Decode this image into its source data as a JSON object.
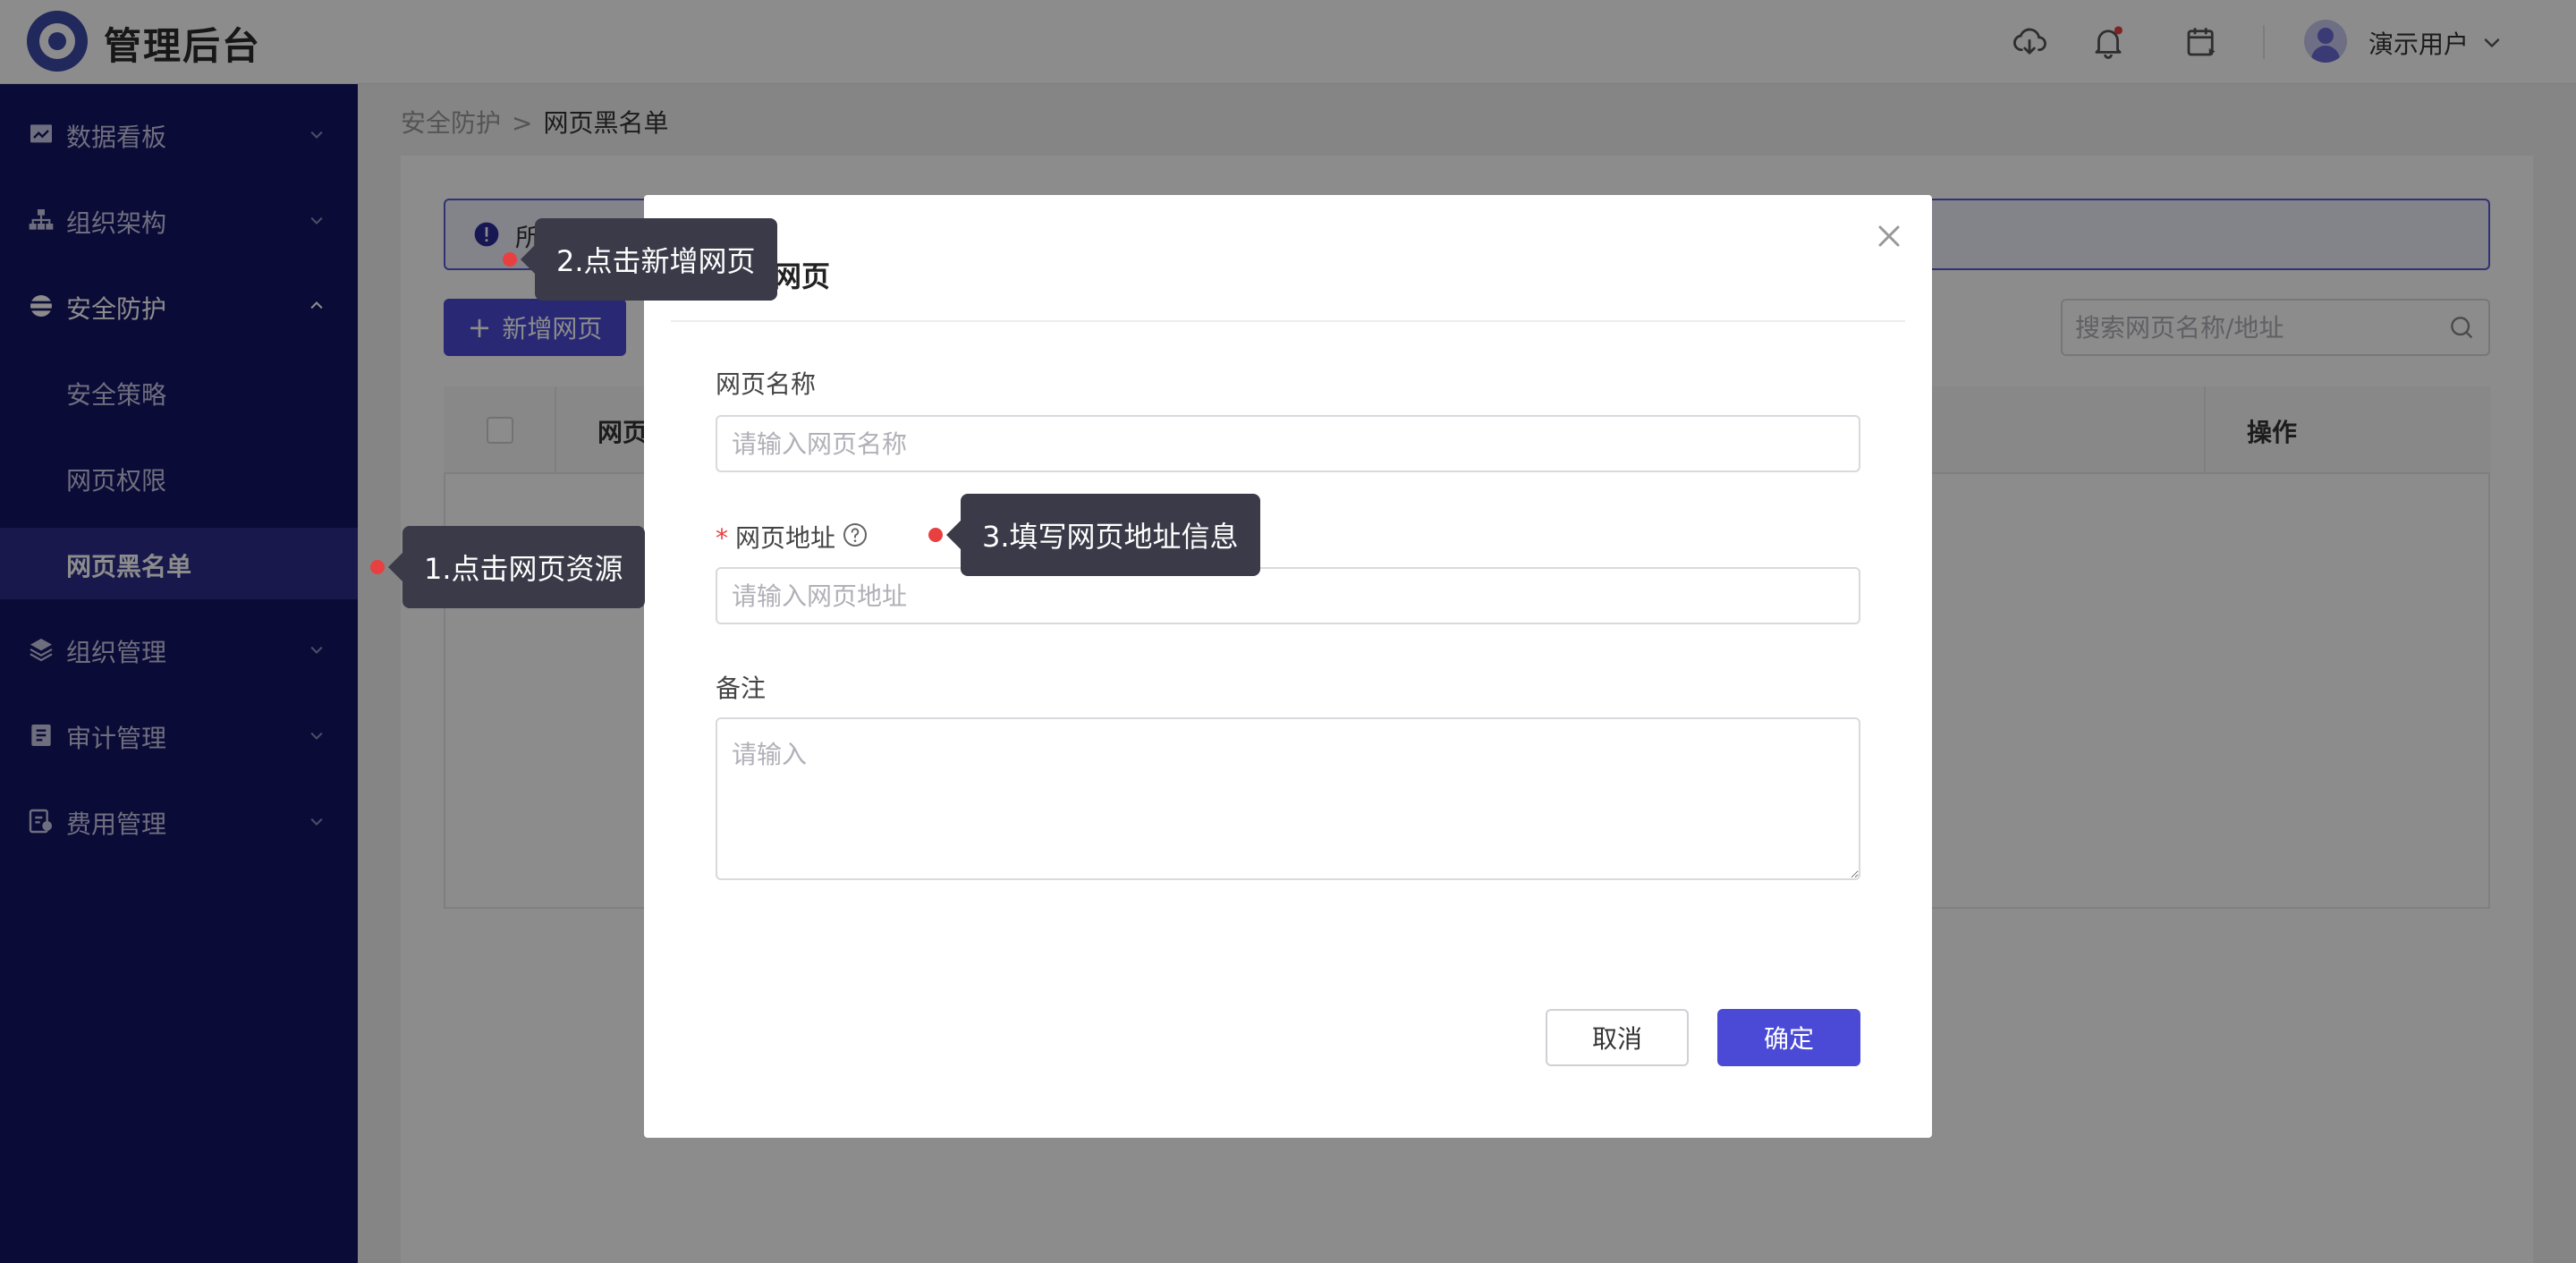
{
  "header": {
    "app_title": "管理后台",
    "icons": [
      "cloud-download-icon",
      "bell-icon",
      "calendar-icon"
    ],
    "user_name": "演示用户"
  },
  "sidebar": {
    "items": [
      {
        "label": "数据看板",
        "icon": "chart-icon"
      },
      {
        "label": "组织架构",
        "icon": "org-chart-icon"
      },
      {
        "label": "安全防护",
        "icon": "shield-icon"
      },
      {
        "label": "安全策略"
      },
      {
        "label": "网页权限"
      },
      {
        "label": "网页黑名单"
      },
      {
        "label": "组织管理",
        "icon": "layers-icon"
      },
      {
        "label": "审计管理",
        "icon": "audit-icon"
      },
      {
        "label": "费用管理",
        "icon": "fee-icon"
      }
    ],
    "active_color": "#2c2c8a",
    "bg_color": "#141466"
  },
  "breadcrumb": {
    "parent": "安全防护",
    "current": "网页黑名单"
  },
  "content": {
    "alert_text": "所",
    "add_button": "新增网页",
    "search_placeholder": "搜索网页名称/地址",
    "table_headers": {
      "name": "网页",
      "op": "操作"
    }
  },
  "modal": {
    "title": "新增网页",
    "fields": {
      "name": {
        "label": "网页名称",
        "placeholder": "请输入网页名称"
      },
      "url": {
        "label": "网页地址",
        "required_mark": "*",
        "placeholder": "请输入网页地址"
      },
      "note": {
        "label": "备注",
        "placeholder": "请输入"
      }
    },
    "cancel": "取消",
    "ok": "确定",
    "accent_color": "#4a4ad6"
  },
  "guide": {
    "step1": "1.点击网页资源",
    "step2": "2.点击新增网页",
    "step3": "3.填写网页地址信息"
  }
}
